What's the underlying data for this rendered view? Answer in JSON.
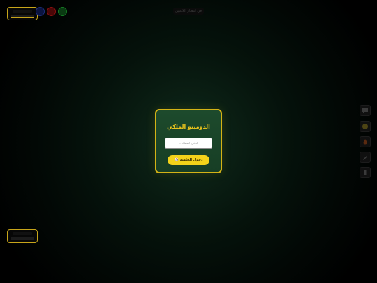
{
  "dialog": {
    "title": "الدومينو الملكي",
    "name_placeholder": "أدخل اسمك...",
    "enter_label": "دخول الجلسة",
    "enter_icon": "🎲"
  },
  "status": {
    "text": "في انتظار اللاعبين"
  },
  "player_colors": {
    "blue": "#1c2e7a",
    "red": "#8a1010",
    "green": "#157a23"
  },
  "tools": [
    {
      "name": "chat-icon"
    },
    {
      "name": "emoji-icon"
    },
    {
      "name": "fire-icon"
    },
    {
      "name": "pencil-icon"
    },
    {
      "name": "card-icon"
    }
  ],
  "theme": {
    "accent": "#d4b316",
    "felt": "#1d4a2c",
    "button": "#f3d21a"
  }
}
